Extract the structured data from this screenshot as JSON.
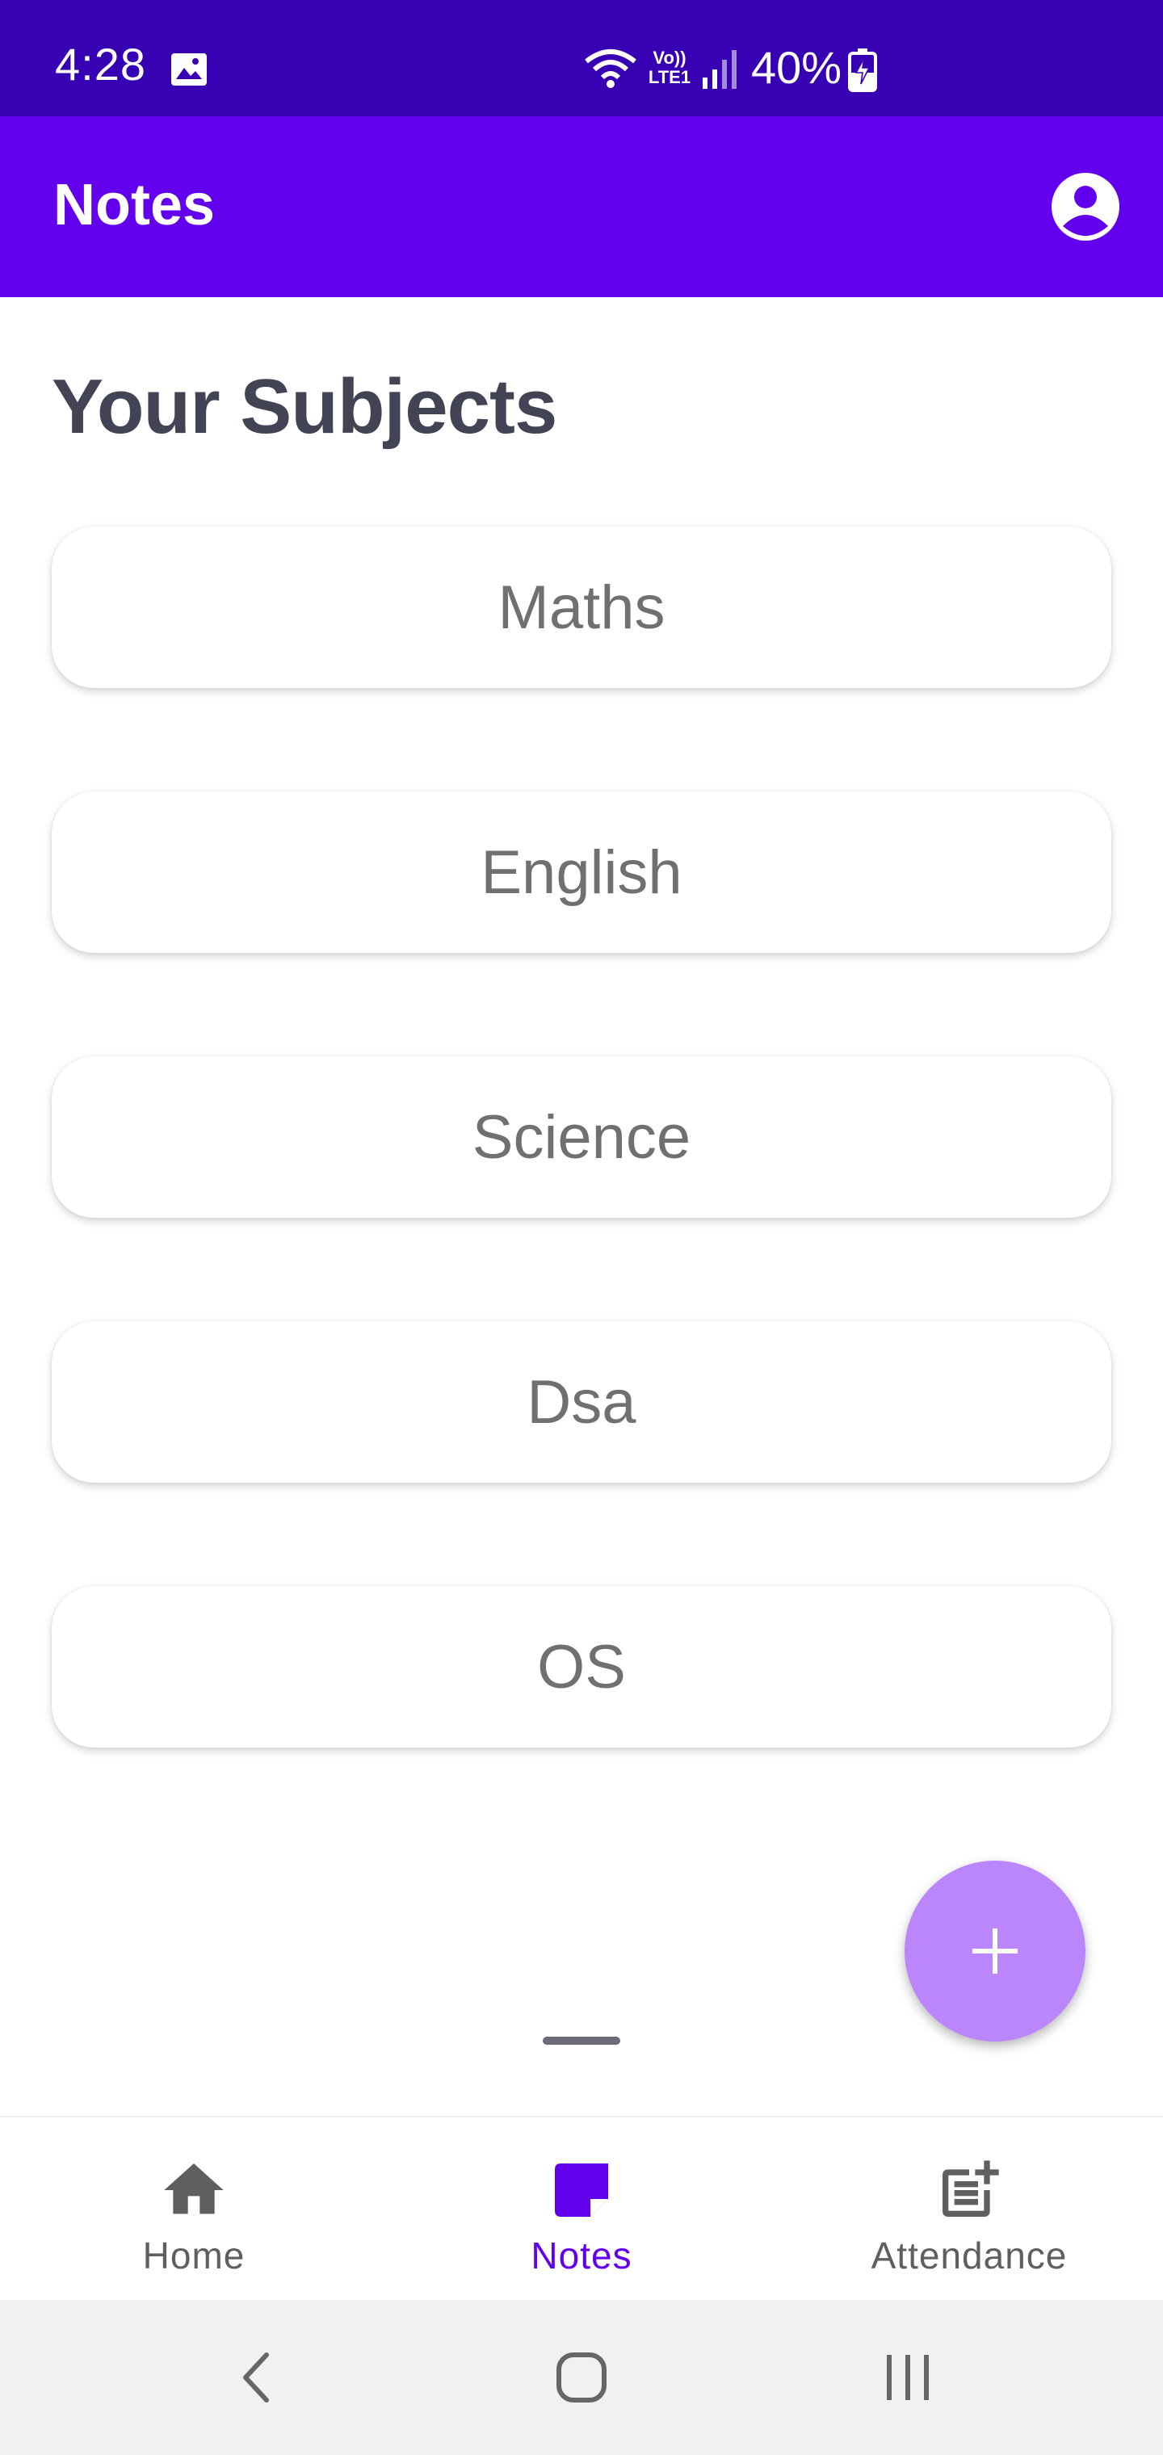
{
  "status_bar": {
    "time": "4:28",
    "network_label": "Vo)) LTE1",
    "battery": "40%",
    "icons": [
      "gallery-icon",
      "wifi-icon",
      "volte-icon",
      "signal-icon",
      "battery-charging-icon"
    ]
  },
  "app_bar": {
    "title": "Notes",
    "account_icon": "account-circle-icon"
  },
  "main": {
    "section_title": "Your Subjects",
    "subjects": [
      "Maths",
      "English",
      "Science",
      "Dsa",
      "OS"
    ],
    "fab_icon": "plus-icon"
  },
  "bottom_nav": {
    "items": [
      {
        "label": "Home",
        "icon": "home-icon",
        "active": false
      },
      {
        "label": "Notes",
        "icon": "note-icon",
        "active": true
      },
      {
        "label": "Attendance",
        "icon": "post-add-icon",
        "active": false
      }
    ]
  },
  "system_nav": {
    "icons": [
      "back-icon",
      "home-circle-icon",
      "recents-icon"
    ]
  },
  "colors": {
    "status_bar": "#3700B3",
    "primary": "#6200EE",
    "fab": "#BB86FC",
    "title_text": "#434356",
    "subject_text": "#707070",
    "nav_inactive": "#5f5f5f"
  }
}
